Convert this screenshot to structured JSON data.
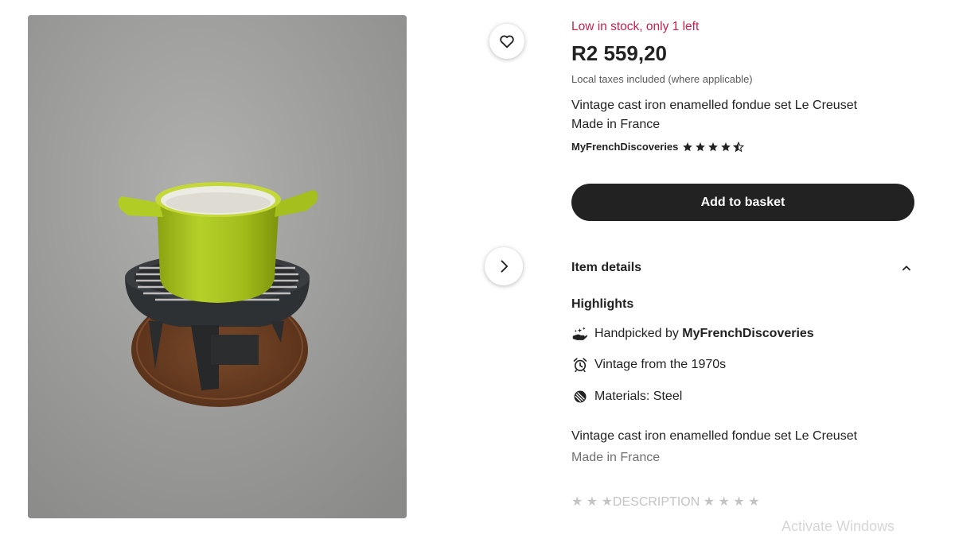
{
  "product": {
    "image_alt": "Green enamelled cast iron fondue pot on black stand with wooden tray",
    "stock_status": "Low in stock, only 1 left",
    "price": "R2 559,20",
    "tax_note": "Local taxes included (where applicable)",
    "title_line1": "Vintage cast iron enamelled fondue set Le Creuset",
    "title_line2": "Made in France",
    "shop_name": "MyFrenchDiscoveries",
    "rating": 4.5,
    "rating_max": 5
  },
  "actions": {
    "add_to_basket": "Add to basket"
  },
  "details": {
    "section_title": "Item details",
    "highlights_title": "Highlights",
    "highlights": [
      {
        "icon": "hand-icon",
        "prefix": "Handpicked by ",
        "bold": "MyFrenchDiscoveries"
      },
      {
        "icon": "alarm-clock-icon",
        "text": "Vintage from the 1970s"
      },
      {
        "icon": "materials-icon",
        "text": "Materials: Steel"
      }
    ],
    "description_line1": "Vintage cast iron enamelled fondue set Le Creuset",
    "description_line2": "Made in France",
    "description_line3": "★ ★ ★DESCRIPTION ★ ★ ★ ★"
  },
  "system": {
    "watermark": "Activate Windows"
  },
  "colors": {
    "stock_red": "#c91f4b",
    "button_dark": "#222222",
    "pot_green": "#a6c21a"
  }
}
